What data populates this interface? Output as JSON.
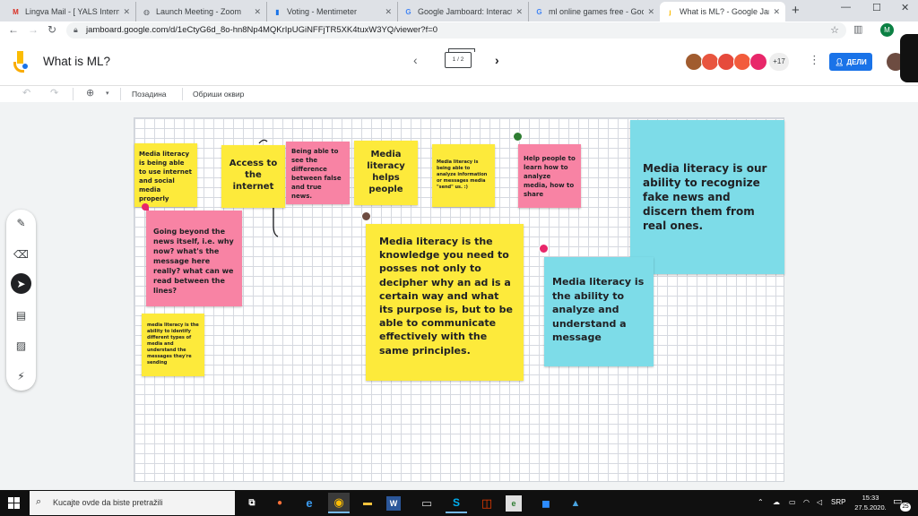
{
  "browser": {
    "tabs": [
      {
        "title": "Lingva Mail - [ YALS Interno",
        "icon": "gmail-icon"
      },
      {
        "title": "Launch Meeting - Zoom",
        "icon": "globe-icon"
      },
      {
        "title": "Voting - Mentimeter",
        "icon": "mentimeter-icon"
      },
      {
        "title": "Google Jamboard: Interactiv",
        "icon": "google-icon"
      },
      {
        "title": "ml online games free - Goo",
        "icon": "google-icon"
      },
      {
        "title": "What is ML? - Google Jambo",
        "icon": "jamboard-icon",
        "active": true
      }
    ],
    "new_tab": "+",
    "window_controls": {
      "minimize": "—",
      "maximize": "☐",
      "close": "✕"
    },
    "address": {
      "url": "jamboard.google.com/d/1eCtyG6d_8o-hn8Np4MQKrIpUGiNFFjTR5XK4tuxW3YQ/viewer?f=0"
    },
    "profile_initial": "M"
  },
  "app": {
    "title": "What is ML?",
    "pager": "1 / 2",
    "collaborators_more": "+17",
    "share_label": "ДЕЛИ",
    "colors": {
      "share": "#1a73e8",
      "accent_yellow": "#fbbc04"
    }
  },
  "toolbar": {
    "background_label": "Позадина",
    "clear_label": "Обриши оквир",
    "zoom_icon": "zoom-icon"
  },
  "notes": [
    {
      "id": "n1",
      "text": "Media literacy is being able to use internet and social media properly",
      "color": "#fdea3b"
    },
    {
      "id": "n2",
      "text": "Access to the internet",
      "color": "#fdea3b"
    },
    {
      "id": "n3",
      "text": "Being able to see the difference between false and true news.",
      "color": "#f883a4"
    },
    {
      "id": "n4",
      "text": "Media literacy helps people",
      "color": "#fdea3b"
    },
    {
      "id": "n5",
      "text": "Media literacy is being able to analyze information or messages media \"send\" us. :)",
      "color": "#fdea3b"
    },
    {
      "id": "n6",
      "text": "Help people to learn how to analyze media, how to share",
      "color": "#f883a4"
    },
    {
      "id": "n7",
      "text": "Media literacy is our ability to recognize fake news and discern them from real ones.",
      "color": "#7ddce8"
    },
    {
      "id": "n8",
      "text": "Going beyond the news itself, i.e. why now? what's the message here really? what can we read between the lines?",
      "color": "#f883a4"
    },
    {
      "id": "n9",
      "text": "Media literacy is the knowledge you need to posses not only to decipher why an ad is a certain way and what its purpose is, but to be able to communicate effectively with the same principles.",
      "color": "#fdea3b"
    },
    {
      "id": "n10",
      "text": "Media literacy is the ability to analyze and understand a message",
      "color": "#7ddce8"
    },
    {
      "id": "n11",
      "text": "media literacy is the ability to identify different types of media and understand the messages they're sending",
      "color": "#fdea3b"
    }
  ],
  "taskbar": {
    "search_placeholder": "Kucajte ovde da biste pretražili",
    "apps": [
      {
        "name": "task-view",
        "label": "⧉"
      },
      {
        "name": "firefox",
        "label": "●"
      },
      {
        "name": "edge",
        "label": "e"
      },
      {
        "name": "chrome",
        "label": "◉"
      },
      {
        "name": "file-explorer",
        "label": "▬"
      },
      {
        "name": "word",
        "label": "W"
      },
      {
        "name": "app-window",
        "label": "▭"
      },
      {
        "name": "skype",
        "label": "S"
      },
      {
        "name": "office",
        "label": "◫"
      },
      {
        "name": "eplanet",
        "label": "e"
      },
      {
        "name": "zoom",
        "label": "◼"
      },
      {
        "name": "photos",
        "label": "▲"
      }
    ],
    "language": "SRP",
    "time": "15:33",
    "date": "27.5.2020.",
    "notifications": "25"
  }
}
